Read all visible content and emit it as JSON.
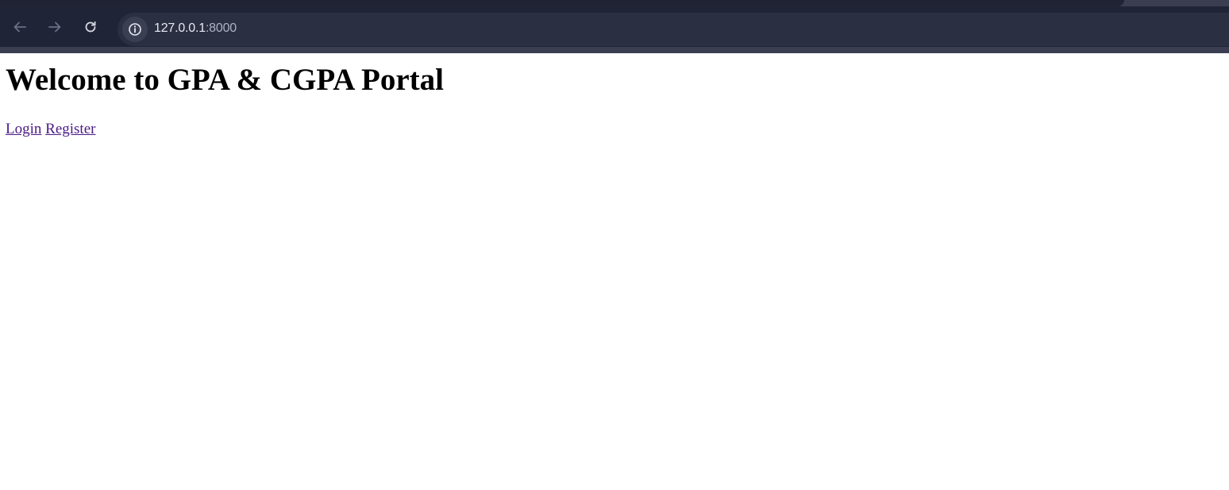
{
  "browser": {
    "url_host": "127.0.0.1",
    "url_port": ":8000",
    "icons": {
      "back": "arrow-left-icon",
      "forward": "arrow-right-icon",
      "reload": "reload-icon",
      "site_info": "info-icon"
    },
    "colors": {
      "toolbar": "#202437",
      "frame": "#3a3e50",
      "omnibox": "#2b2f42"
    }
  },
  "page": {
    "heading": "Welcome to GPA & CGPA Portal",
    "links": [
      {
        "label": "Login"
      },
      {
        "label": "Register"
      }
    ],
    "link_color": "#4b1a85"
  }
}
